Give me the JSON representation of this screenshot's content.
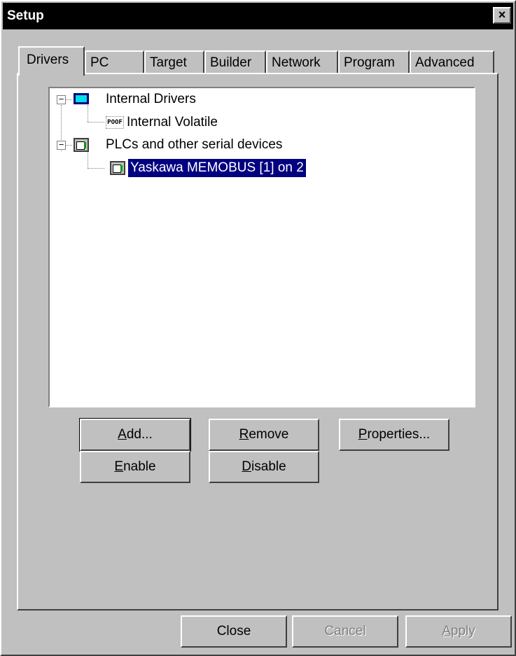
{
  "window": {
    "title": "Setup",
    "close_glyph": "×"
  },
  "tabs": [
    {
      "label": "Drivers",
      "active": true
    },
    {
      "label": "PC"
    },
    {
      "label": "Target"
    },
    {
      "label": "Builder"
    },
    {
      "label": "Network"
    },
    {
      "label": "Program"
    },
    {
      "label": "Advanced"
    }
  ],
  "tree": {
    "nodes": [
      {
        "label": "Internal Drivers",
        "icon": "monitor-icon",
        "expander": "−"
      },
      {
        "label": "Internal Volatile",
        "icon": "poof-icon",
        "icon_text": "POOF"
      },
      {
        "label": "PLCs and other serial devices",
        "icon": "plc-icon",
        "expander": "−"
      },
      {
        "label": "Yaskawa MEMOBUS [1] on 2",
        "icon": "plc-icon",
        "selected": true
      }
    ]
  },
  "buttons": {
    "add": {
      "pre": "",
      "key": "A",
      "post": "dd..."
    },
    "remove": {
      "pre": "",
      "key": "R",
      "post": "emove"
    },
    "properties": {
      "pre": "",
      "key": "P",
      "post": "roperties..."
    },
    "enable": {
      "pre": "",
      "key": "E",
      "post": "nable"
    },
    "disable": {
      "pre": "",
      "key": "D",
      "post": "isable"
    }
  },
  "footer": {
    "close": "Close",
    "cancel": "Cancel",
    "apply": {
      "pre": "",
      "key": "A",
      "post": "pply"
    }
  }
}
